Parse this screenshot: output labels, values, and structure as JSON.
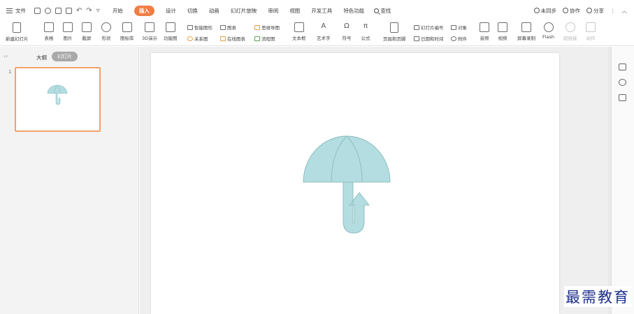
{
  "menu": {
    "file": "文件",
    "tabs": [
      "开始",
      "插入",
      "设计",
      "切换",
      "动画",
      "幻灯片放映",
      "审阅",
      "视图",
      "开发工具",
      "特色功能"
    ],
    "active_tab": "插入",
    "search": "查找"
  },
  "header_right": {
    "sync": "未同步",
    "collaborate": "协作",
    "share": "分享"
  },
  "ribbon": {
    "new_slide": "新建幻灯片",
    "table": "表格",
    "picture": "图片",
    "screenshot": "截屏",
    "shape": "形状",
    "icon_lib": "图标库",
    "demo3d": "3D演示",
    "func_chart": "功能图",
    "smart_art": "智能图形",
    "chart": "图表",
    "relation": "关系图",
    "online_chart": "在线图表",
    "mind_map": "思维导图",
    "flowchart": "流程图",
    "textbox": "文本框",
    "art_text": "艺术字",
    "symbol": "符号",
    "formula": "公式",
    "header_footer": "页眉和页脚",
    "slide_number": "幻灯片编号",
    "object": "对象",
    "date_time": "日期和时间",
    "attachment": "附件",
    "audio": "音频",
    "video": "视频",
    "screen_record": "屏幕录制",
    "flash": "Flash",
    "hyperlink": "超链接",
    "action": "动作"
  },
  "panel": {
    "outline_tab": "大纲",
    "slides_tab": "幻灯片",
    "slide_number": "1"
  },
  "colors": {
    "accent": "#f17d45",
    "umbrella_fill": "#b3dde0",
    "umbrella_stroke": "#8fbec3"
  },
  "watermark": "最需教育"
}
